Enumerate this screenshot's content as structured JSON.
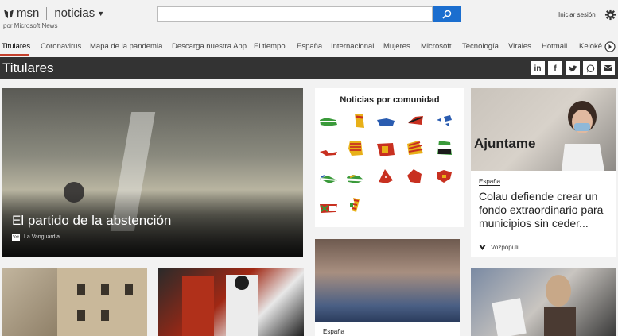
{
  "header": {
    "brand": "msn",
    "section": "noticias",
    "by_line": "por Microsoft News",
    "search_placeholder": "",
    "signin": "Iniciar sesión"
  },
  "nav": {
    "items": [
      "Titulares",
      "Coronavirus",
      "Mapa de la pandemia",
      "Descarga nuestra App",
      "El tiempo",
      "España",
      "Internacional",
      "Mujeres",
      "Microsoft",
      "Tecnología",
      "Virales",
      "Hotmail",
      "Kelokê"
    ]
  },
  "page_title": "Titulares",
  "share_icons": [
    "linkedin-icon",
    "facebook-icon",
    "twitter-icon",
    "whatsapp-icon",
    "mail-icon"
  ],
  "hero": {
    "title": "El partido de la abstención",
    "source": "La Vanguardia",
    "source_icon": "Vdt"
  },
  "community": {
    "title": "Noticias por comunidad"
  },
  "side_card": {
    "sign_text": "Ajuntame",
    "category": "España",
    "headline": "Colau defiende crear un fondo extraordinario para municipios sin ceder...",
    "source": "Vozpópuli"
  },
  "photo_card": {
    "category": "España"
  },
  "colors": {
    "accent": "#c4402c",
    "search_button": "#1b6ecf",
    "title_bar": "#333333"
  }
}
